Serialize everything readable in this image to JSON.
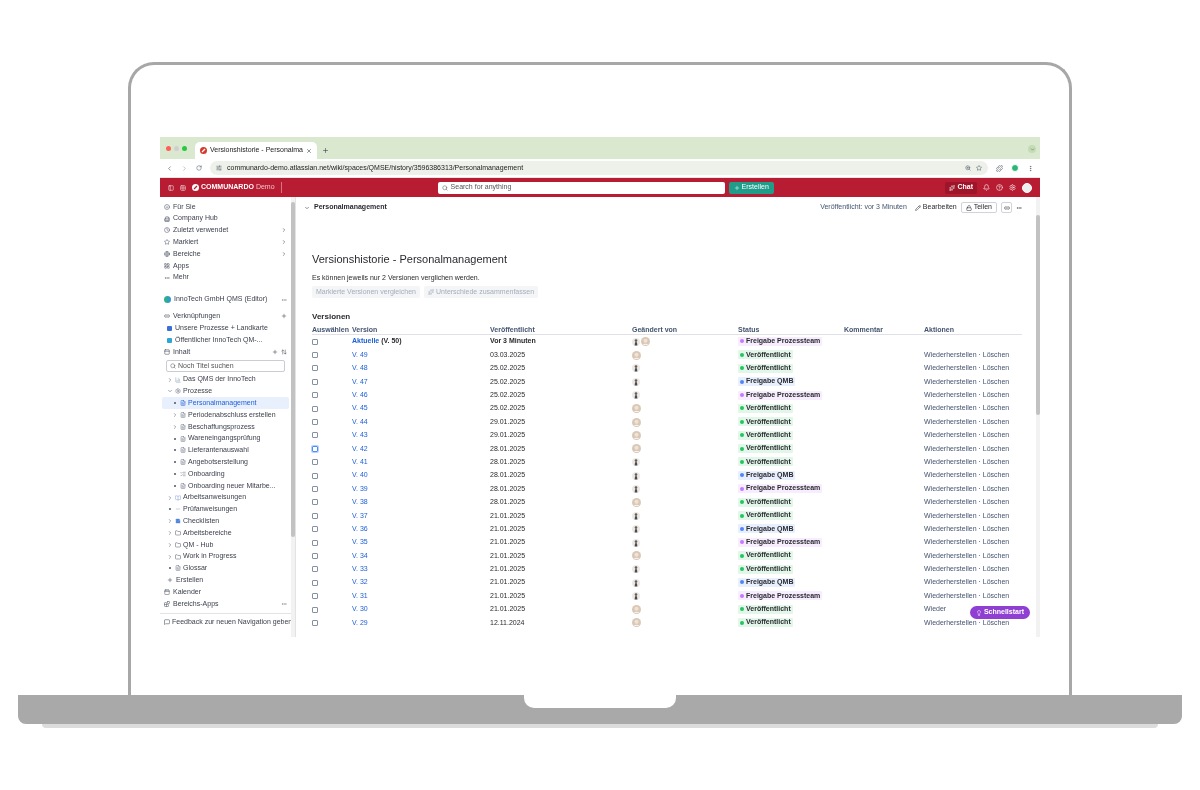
{
  "browser": {
    "tab_title": "Versionshistorie - Personalma",
    "url": "communardo-demo.atlassian.net/wiki/spaces/QMSE/history/3596386313/Personalmanagement"
  },
  "app_header": {
    "logo": "COMMUNARDO",
    "logo_suffix": "Demo",
    "search_placeholder": "Search for anything",
    "create": "Erstellen",
    "chat": "Chat"
  },
  "sidebar": {
    "nav": [
      {
        "label": "Für Sie",
        "kind": "face",
        "chevron": false
      },
      {
        "label": "Company Hub",
        "kind": "building",
        "chevron": false
      },
      {
        "label": "Zuletzt verwendet",
        "kind": "clock",
        "chevron": true
      },
      {
        "label": "Markiert",
        "kind": "star",
        "chevron": true
      },
      {
        "label": "Bereiche",
        "kind": "globe",
        "chevron": true
      },
      {
        "label": "Apps",
        "kind": "grid",
        "chevron": false
      },
      {
        "label": "Mehr",
        "kind": "dots",
        "chevron": false
      }
    ],
    "space": "InnoTech GmbH QMS (Editor)",
    "shortcuts": {
      "label": "Verknüpfungen",
      "items": [
        {
          "label": "Unsere Prozesse + Landkarte",
          "color": "#3b6fd8"
        },
        {
          "label": "Öffentlicher InnoTech QM-...",
          "color": "#2fa4d8"
        }
      ]
    },
    "content": {
      "label": "Inhalt",
      "search_placeholder": "Noch Titel suchen",
      "tree": [
        {
          "label": "Das QMS der InnoTech",
          "kind": "chart",
          "expandable": true,
          "selected": false
        },
        {
          "label": "Prozesse",
          "kind": "gear",
          "expandable": true,
          "expanded": true,
          "selected": false,
          "children": [
            {
              "label": "Personalmanagement",
              "kind": "page",
              "expandable": false,
              "selected": true
            },
            {
              "label": "Periodenabschluss erstellen",
              "kind": "page",
              "expandable": true,
              "selected": false
            },
            {
              "label": "Beschaffungsprozess",
              "kind": "page",
              "expandable": true,
              "selected": false
            },
            {
              "label": "Wareneingangsprüfung",
              "kind": "page",
              "expandable": false,
              "selected": false
            },
            {
              "label": "Lieferantenauswahl",
              "kind": "page",
              "expandable": false,
              "selected": false
            },
            {
              "label": "Angebotserstellung",
              "kind": "page",
              "expandable": false,
              "selected": false
            },
            {
              "label": "Onboarding",
              "kind": "list",
              "expandable": false,
              "selected": false
            },
            {
              "label": "Onboarding neuer Mitarbe...",
              "kind": "page",
              "expandable": false,
              "selected": false
            }
          ]
        },
        {
          "label": "Arbeitsanweisungen",
          "kind": "book",
          "expandable": true,
          "selected": false
        },
        {
          "label": "Prüfanweisungen",
          "kind": "dash",
          "expandable": false,
          "selected": false
        },
        {
          "label": "Checklisten",
          "kind": "check",
          "expandable": true,
          "selected": false
        },
        {
          "label": "Arbeitsbereiche",
          "kind": "folder",
          "expandable": true,
          "selected": false
        },
        {
          "label": "QM - Hub",
          "kind": "folder",
          "expandable": true,
          "selected": false
        },
        {
          "label": "Work in Progress",
          "kind": "folder",
          "expandable": true,
          "selected": false
        },
        {
          "label": "Glossar",
          "kind": "page",
          "expandable": false,
          "selected": false
        }
      ]
    },
    "create": "Erstellen",
    "bottom": [
      {
        "label": "Kalender",
        "kind": "calendar",
        "menu": false
      },
      {
        "label": "Bereichs-Apps",
        "kind": "apps",
        "menu": true
      }
    ],
    "feedback": "Feedback zur neuen Navigation geben"
  },
  "page_header": {
    "breadcrumb": "Personalmanagement",
    "published": "Veröffentlicht: vor 3 Minuten",
    "edit": "Bearbeiten",
    "share": "Teilen"
  },
  "title": "Versionshistorie - Personalmanagement",
  "note": "Es können jeweils nur 2 Versionen verglichen werden.",
  "buttons": [
    {
      "label": "Markierte Versionen vergleichen",
      "icon": false,
      "disabled": true
    },
    {
      "label": "Unterschiede zusammenfassen",
      "icon": true,
      "disabled": true
    }
  ],
  "section": "Versionen",
  "table": {
    "columns": [
      "Auswählen",
      "Version",
      "Veröffentlicht",
      "Geändert von",
      "Status",
      "Kommentar",
      "Aktionen"
    ],
    "rows": [
      {
        "link": "Aktuelle",
        "suffix": "(V. 50)",
        "date": "Vor 3 Minuten",
        "current": true,
        "focused": false,
        "avatars": [
          {
            "kind": "standing"
          },
          {
            "kind": "round"
          }
        ],
        "status": "Freigabe Prozessteam",
        "color": "#c27aff"
      },
      {
        "link": "V. 49",
        "date": "03.03.2025",
        "current": false,
        "focused": false,
        "avatars": [
          {
            "kind": "round"
          }
        ],
        "status": "Veröffentlicht",
        "color": "#22c55e",
        "actions": "Wiederherstellen · Löschen"
      },
      {
        "link": "V. 48",
        "date": "25.02.2025",
        "current": false,
        "focused": false,
        "avatars": [
          {
            "kind": "standing"
          }
        ],
        "status": "Veröffentlicht",
        "color": "#22c55e",
        "actions": "Wiederherstellen · Löschen"
      },
      {
        "link": "V. 47",
        "date": "25.02.2025",
        "current": false,
        "focused": false,
        "avatars": [
          {
            "kind": "standing"
          }
        ],
        "status": "Freigabe QMB",
        "color": "#4f86f7",
        "actions": "Wiederherstellen · Löschen"
      },
      {
        "link": "V. 46",
        "date": "25.02.2025",
        "current": false,
        "focused": false,
        "avatars": [
          {
            "kind": "standing"
          }
        ],
        "status": "Freigabe Prozessteam",
        "color": "#c27aff",
        "actions": "Wiederherstellen · Löschen"
      },
      {
        "link": "V. 45",
        "date": "25.02.2025",
        "current": false,
        "focused": false,
        "avatars": [
          {
            "kind": "round"
          }
        ],
        "status": "Veröffentlicht",
        "color": "#22c55e",
        "actions": "Wiederherstellen · Löschen"
      },
      {
        "link": "V. 44",
        "date": "29.01.2025",
        "current": false,
        "focused": false,
        "avatars": [
          {
            "kind": "round"
          }
        ],
        "status": "Veröffentlicht",
        "color": "#22c55e",
        "actions": "Wiederherstellen · Löschen"
      },
      {
        "link": "V. 43",
        "date": "29.01.2025",
        "current": false,
        "focused": false,
        "avatars": [
          {
            "kind": "round"
          }
        ],
        "status": "Veröffentlicht",
        "color": "#22c55e",
        "actions": "Wiederherstellen · Löschen"
      },
      {
        "link": "V. 42",
        "date": "28.01.2025",
        "current": false,
        "focused": true,
        "avatars": [
          {
            "kind": "round"
          }
        ],
        "status": "Veröffentlicht",
        "color": "#22c55e",
        "actions": "Wiederherstellen · Löschen"
      },
      {
        "link": "V. 41",
        "date": "28.01.2025",
        "current": false,
        "focused": false,
        "avatars": [
          {
            "kind": "standing"
          }
        ],
        "status": "Veröffentlicht",
        "color": "#22c55e",
        "actions": "Wiederherstellen · Löschen"
      },
      {
        "link": "V. 40",
        "date": "28.01.2025",
        "current": false,
        "focused": false,
        "avatars": [
          {
            "kind": "standing"
          }
        ],
        "status": "Freigabe QMB",
        "color": "#4f86f7",
        "actions": "Wiederherstellen · Löschen"
      },
      {
        "link": "V. 39",
        "date": "28.01.2025",
        "current": false,
        "focused": false,
        "avatars": [
          {
            "kind": "standing"
          }
        ],
        "status": "Freigabe Prozessteam",
        "color": "#c27aff",
        "actions": "Wiederherstellen · Löschen"
      },
      {
        "link": "V. 38",
        "date": "28.01.2025",
        "current": false,
        "focused": false,
        "avatars": [
          {
            "kind": "round"
          }
        ],
        "status": "Veröffentlicht",
        "color": "#22c55e",
        "actions": "Wiederherstellen · Löschen"
      },
      {
        "link": "V. 37",
        "date": "21.01.2025",
        "current": false,
        "focused": false,
        "avatars": [
          {
            "kind": "standing"
          }
        ],
        "status": "Veröffentlicht",
        "color": "#22c55e",
        "actions": "Wiederherstellen · Löschen"
      },
      {
        "link": "V. 36",
        "date": "21.01.2025",
        "current": false,
        "focused": false,
        "avatars": [
          {
            "kind": "standing"
          }
        ],
        "status": "Freigabe QMB",
        "color": "#4f86f7",
        "actions": "Wiederherstellen · Löschen"
      },
      {
        "link": "V. 35",
        "date": "21.01.2025",
        "current": false,
        "focused": false,
        "avatars": [
          {
            "kind": "standing"
          }
        ],
        "status": "Freigabe Prozessteam",
        "color": "#c27aff",
        "actions": "Wiederherstellen · Löschen"
      },
      {
        "link": "V. 34",
        "date": "21.01.2025",
        "current": false,
        "focused": false,
        "avatars": [
          {
            "kind": "round"
          }
        ],
        "status": "Veröffentlicht",
        "color": "#22c55e",
        "actions": "Wiederherstellen · Löschen"
      },
      {
        "link": "V. 33",
        "date": "21.01.2025",
        "current": false,
        "focused": false,
        "avatars": [
          {
            "kind": "standing"
          }
        ],
        "status": "Veröffentlicht",
        "color": "#22c55e",
        "actions": "Wiederherstellen · Löschen"
      },
      {
        "link": "V. 32",
        "date": "21.01.2025",
        "current": false,
        "focused": false,
        "avatars": [
          {
            "kind": "standing"
          }
        ],
        "status": "Freigabe QMB",
        "color": "#4f86f7",
        "actions": "Wiederherstellen · Löschen"
      },
      {
        "link": "V. 31",
        "date": "21.01.2025",
        "current": false,
        "focused": false,
        "avatars": [
          {
            "kind": "standing"
          }
        ],
        "status": "Freigabe Prozessteam",
        "color": "#c27aff",
        "actions": "Wiederherstellen · Löschen"
      },
      {
        "link": "V. 30",
        "date": "21.01.2025",
        "current": false,
        "focused": false,
        "avatars": [
          {
            "kind": "round"
          }
        ],
        "status": "Veröffentlicht",
        "color": "#22c55e",
        "actions": "Wieder"
      },
      {
        "link": "V. 29",
        "date": "12.11.2024",
        "current": false,
        "focused": false,
        "avatars": [
          {
            "kind": "round"
          }
        ],
        "status": "Veröffentlicht",
        "color": "#22c55e",
        "actions": "Wiederherstellen · Löschen"
      }
    ]
  },
  "quickstart": "Schnellstart"
}
